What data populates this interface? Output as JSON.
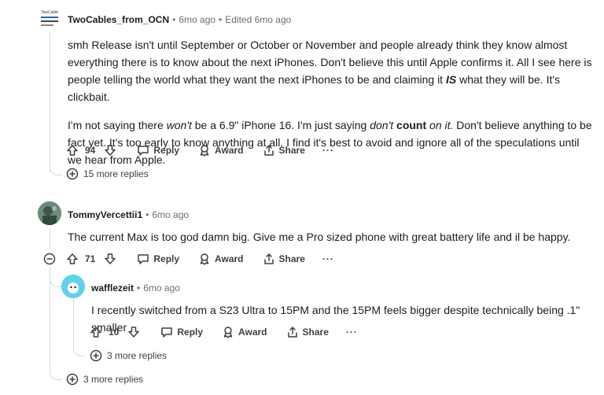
{
  "comments": [
    {
      "author": "TwoCables_from_OCN",
      "time": "6mo ago",
      "edited": "Edited 6mo ago",
      "avatar_text": "TwoCable",
      "paragraph1": "smh Release isn't until September or October or November and people already think they know almost everything there is to know about the next iPhones. Don't believe this until Apple confirms it. All I see here is people telling the world what they want the next iPhones to be and claiming it",
      "paragraph1_em": "IS",
      "paragraph1_end": "what they will be. It's clickbait.",
      "paragraph2_a": "I'm not saying there",
      "paragraph2_em1": "won't",
      "paragraph2_b": "be a 6.9\" iPhone 16. I'm just saying",
      "paragraph2_em2": "don't",
      "paragraph2_strong": "count",
      "paragraph2_em3": "on it.",
      "paragraph2_c": "Don't believe anything to be fact yet. It's too early to know anything at all. I find it's best to avoid and ignore all of the speculations until we hear from Apple.",
      "votes": "94",
      "reply_label": "Reply",
      "award_label": "Award",
      "share_label": "Share",
      "more_replies": "15 more replies"
    },
    {
      "author": "TommyVercettii1",
      "time": "6mo ago",
      "text": "The current Max is too god damn big. Give me a Pro sized phone with great battery life and il be happy.",
      "votes": "71",
      "reply_label": "Reply",
      "award_label": "Award",
      "share_label": "Share",
      "more_replies": "3 more replies"
    },
    {
      "author": "wafflezeit",
      "time": "6mo ago",
      "text": "I recently switched from a S23 Ultra to 15PM and the 15PM feels bigger despite technically being .1\" smaller",
      "votes": "10",
      "reply_label": "Reply",
      "award_label": "Award",
      "share_label": "Share",
      "more_replies": "3 more replies"
    }
  ],
  "colors": {
    "text": "#1c1c1c",
    "muted": "#6b6f73",
    "thread_line": "#d6d9dc",
    "avatar_waffle": "#5fd3e8"
  },
  "icons": [
    "upvote-icon",
    "downvote-icon",
    "reply-icon",
    "award-icon",
    "share-icon",
    "overflow-icon",
    "expand-icon",
    "collapse-icon"
  ]
}
